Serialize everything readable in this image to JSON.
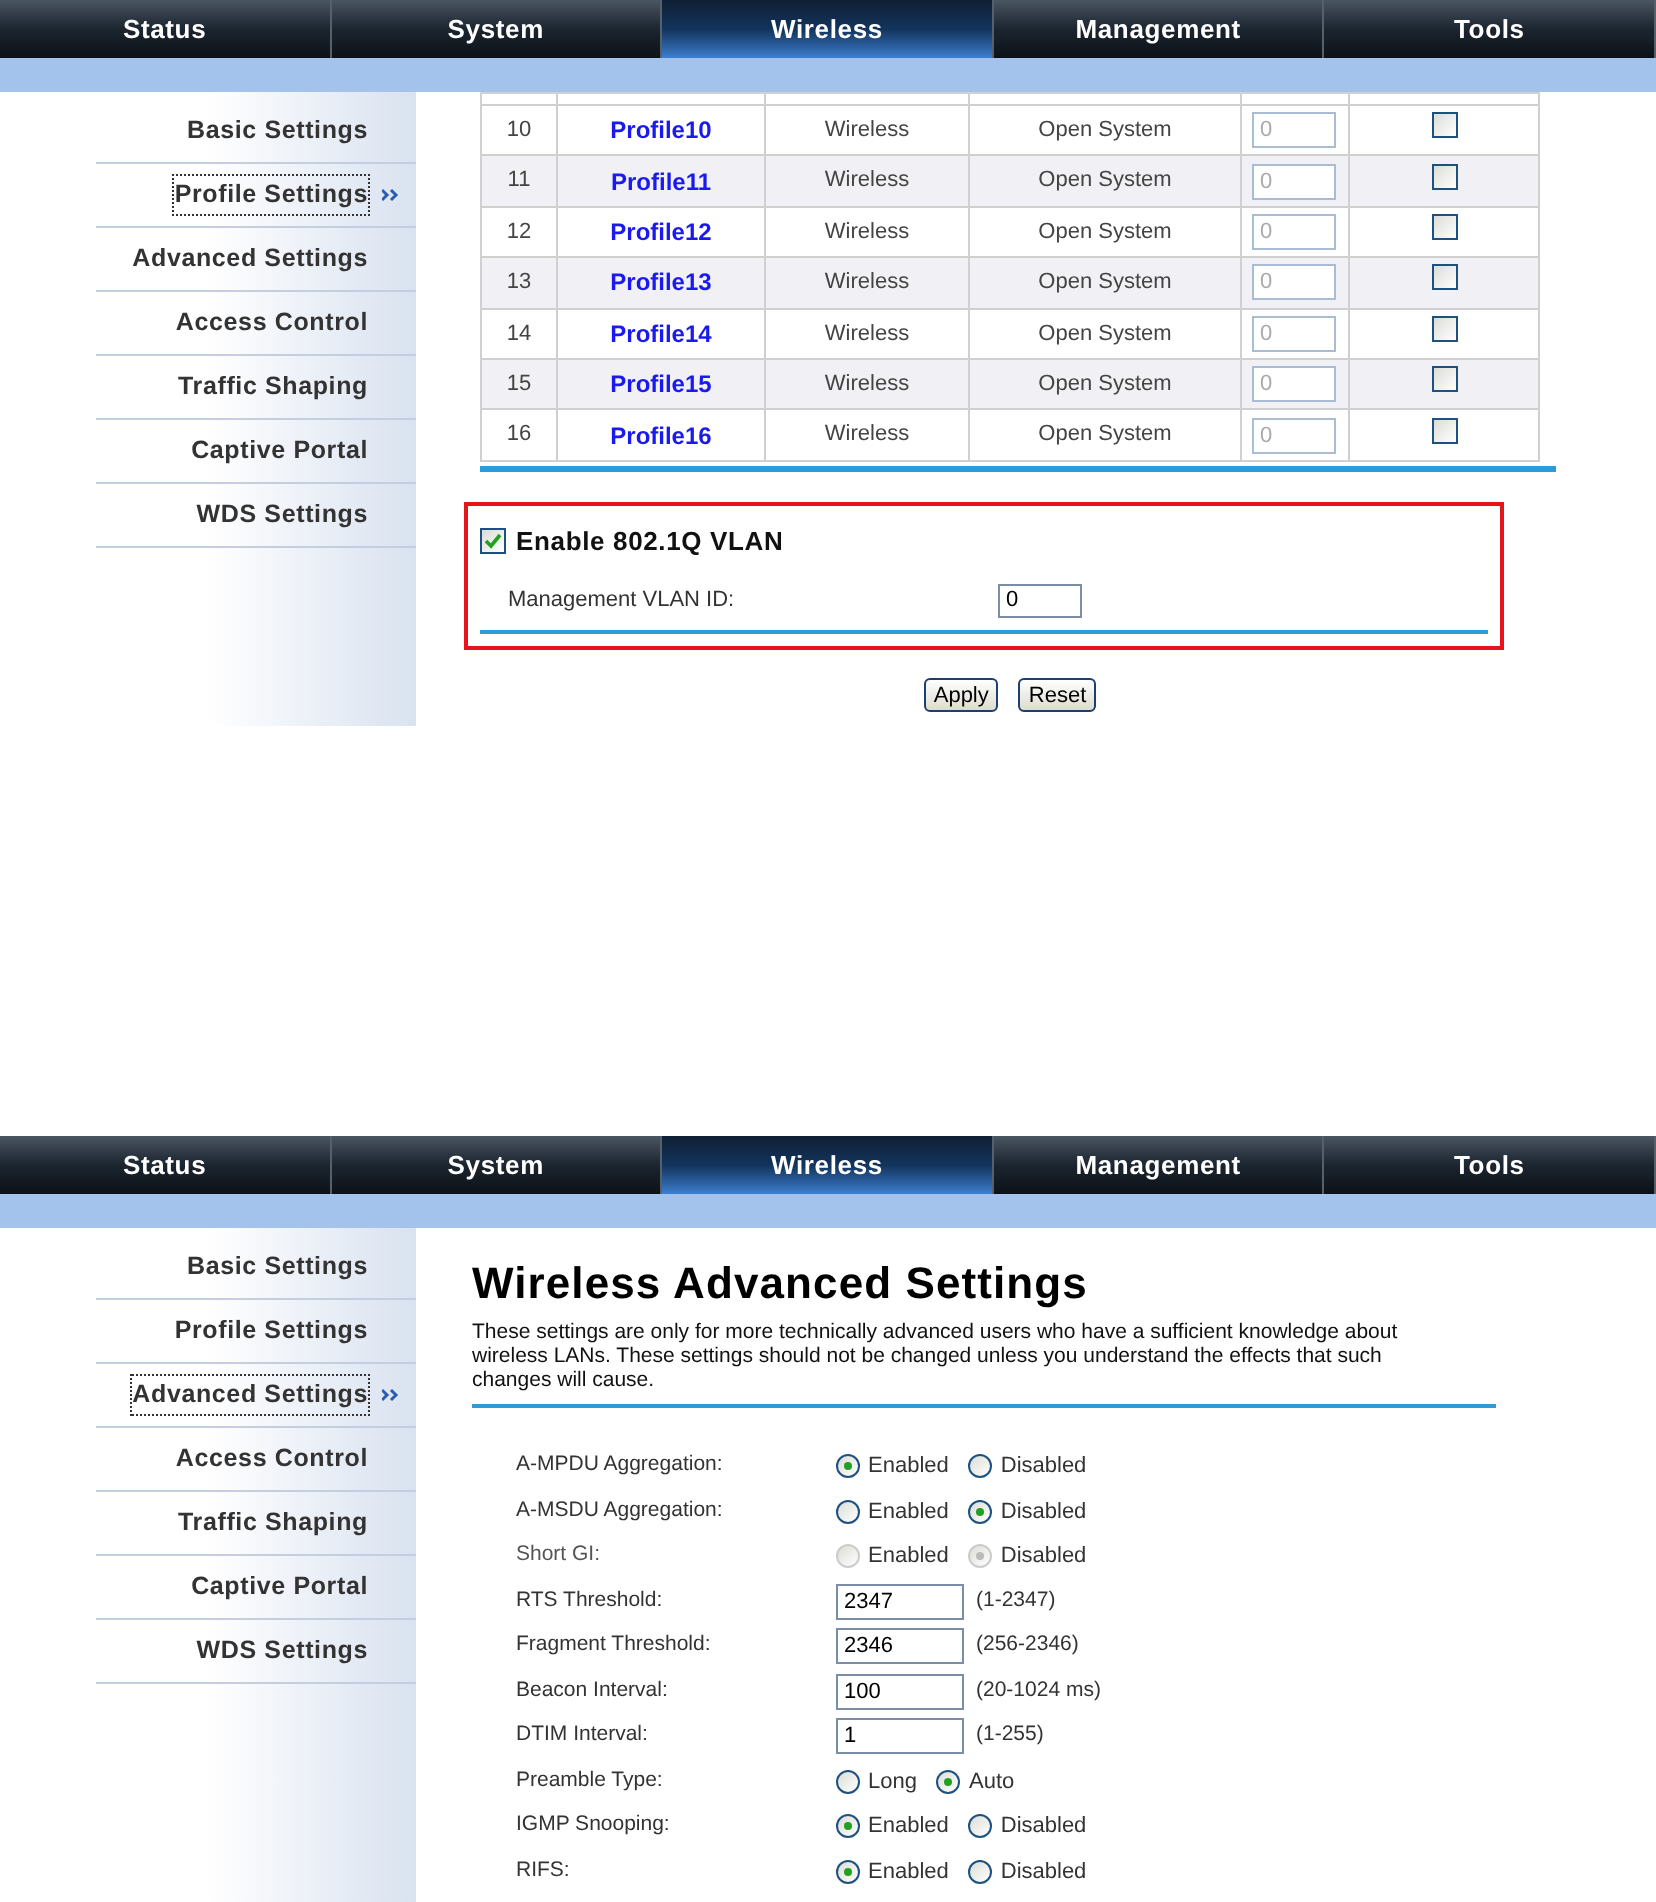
{
  "screens": [
    {
      "kind": "profiles",
      "nav": [
        {
          "label": "Status",
          "selected": false
        },
        {
          "label": "System",
          "selected": false
        },
        {
          "label": "Wireless",
          "selected": true
        },
        {
          "label": "Management",
          "selected": false
        },
        {
          "label": "Tools",
          "selected": false
        }
      ],
      "sidebar": [
        {
          "label": "Basic Settings",
          "selected": false
        },
        {
          "label": "Profile Settings",
          "selected": true
        },
        {
          "label": "Advanced Settings",
          "selected": false
        },
        {
          "label": "Access Control",
          "selected": false
        },
        {
          "label": "Traffic Shaping",
          "selected": false
        },
        {
          "label": "Captive Portal",
          "selected": false
        },
        {
          "label": "WDS Settings",
          "selected": false
        }
      ],
      "rows": [
        {
          "number": "10",
          "name": "Profile10",
          "type": "Wireless",
          "auth": "Open System",
          "vlan": "0",
          "checked": false
        },
        {
          "number": "11",
          "name": "Profile11",
          "type": "Wireless",
          "auth": "Open System",
          "vlan": "0",
          "checked": false
        },
        {
          "number": "12",
          "name": "Profile12",
          "type": "Wireless",
          "auth": "Open System",
          "vlan": "0",
          "checked": false
        },
        {
          "number": "13",
          "name": "Profile13",
          "type": "Wireless",
          "auth": "Open System",
          "vlan": "0",
          "checked": false
        },
        {
          "number": "14",
          "name": "Profile14",
          "type": "Wireless",
          "auth": "Open System",
          "vlan": "0",
          "checked": false
        },
        {
          "number": "15",
          "name": "Profile15",
          "type": "Wireless",
          "auth": "Open System",
          "vlan": "0",
          "checked": false
        },
        {
          "number": "16",
          "name": "Profile16",
          "type": "Wireless",
          "auth": "Open System",
          "vlan": "0",
          "checked": false
        }
      ],
      "vlan": {
        "label": "Enable 802.1Q VLAN",
        "checked": true,
        "id_label": "Management VLAN ID:",
        "id_value": "0"
      },
      "buttons": [
        "Apply",
        "Reset"
      ]
    },
    {
      "kind": "advanced",
      "nav": [
        {
          "label": "Status",
          "selected": false
        },
        {
          "label": "System",
          "selected": false
        },
        {
          "label": "Wireless",
          "selected": true
        },
        {
          "label": "Management",
          "selected": false
        },
        {
          "label": "Tools",
          "selected": false
        }
      ],
      "sidebar": [
        {
          "label": "Basic Settings",
          "selected": false
        },
        {
          "label": "Profile Settings",
          "selected": false
        },
        {
          "label": "Advanced Settings",
          "selected": true
        },
        {
          "label": "Access Control",
          "selected": false
        },
        {
          "label": "Traffic Shaping",
          "selected": false
        },
        {
          "label": "Captive Portal",
          "selected": false
        },
        {
          "label": "WDS Settings",
          "selected": false
        }
      ],
      "title": "Wireless Advanced Settings",
      "description": "These settings are only for more technically advanced users who have a sufficient knowledge about wireless LANs. These settings should not be changed unless you understand the effects that such changes will cause.",
      "settings": [
        {
          "kind": "radio",
          "label": "A-MPDU Aggregation:",
          "disabled": false,
          "options": [
            {
              "label": "Enabled",
              "selected": true
            },
            {
              "label": "Disabled",
              "selected": false
            }
          ]
        },
        {
          "kind": "radio",
          "label": "A-MSDU Aggregation:",
          "disabled": false,
          "options": [
            {
              "label": "Enabled",
              "selected": false
            },
            {
              "label": "Disabled",
              "selected": true
            }
          ]
        },
        {
          "kind": "radio",
          "label": "Short GI:",
          "disabled": true,
          "options": [
            {
              "label": "Enabled",
              "selected": false
            },
            {
              "label": "Disabled",
              "selected": true
            }
          ]
        },
        {
          "kind": "input",
          "label": "RTS Threshold:",
          "value": "2347",
          "range": "(1-2347)"
        },
        {
          "kind": "input",
          "label": "Fragment Threshold:",
          "value": "2346",
          "range": "(256-2346)"
        },
        {
          "kind": "input",
          "label": "Beacon Interval:",
          "value": "100",
          "range": "(20-1024 ms)"
        },
        {
          "kind": "input",
          "label": "DTIM Interval:",
          "value": "1",
          "range": "(1-255)"
        },
        {
          "kind": "radio",
          "label": "Preamble Type:",
          "disabled": false,
          "options": [
            {
              "label": "Long",
              "selected": false
            },
            {
              "label": "Auto",
              "selected": true
            }
          ]
        },
        {
          "kind": "radio",
          "label": "IGMP Snooping:",
          "disabled": false,
          "options": [
            {
              "label": "Enabled",
              "selected": true
            },
            {
              "label": "Disabled",
              "selected": false
            }
          ]
        },
        {
          "kind": "radio",
          "label": "RIFS:",
          "disabled": false,
          "options": [
            {
              "label": "Enabled",
              "selected": true
            },
            {
              "label": "Disabled",
              "selected": false
            }
          ]
        }
      ]
    }
  ]
}
